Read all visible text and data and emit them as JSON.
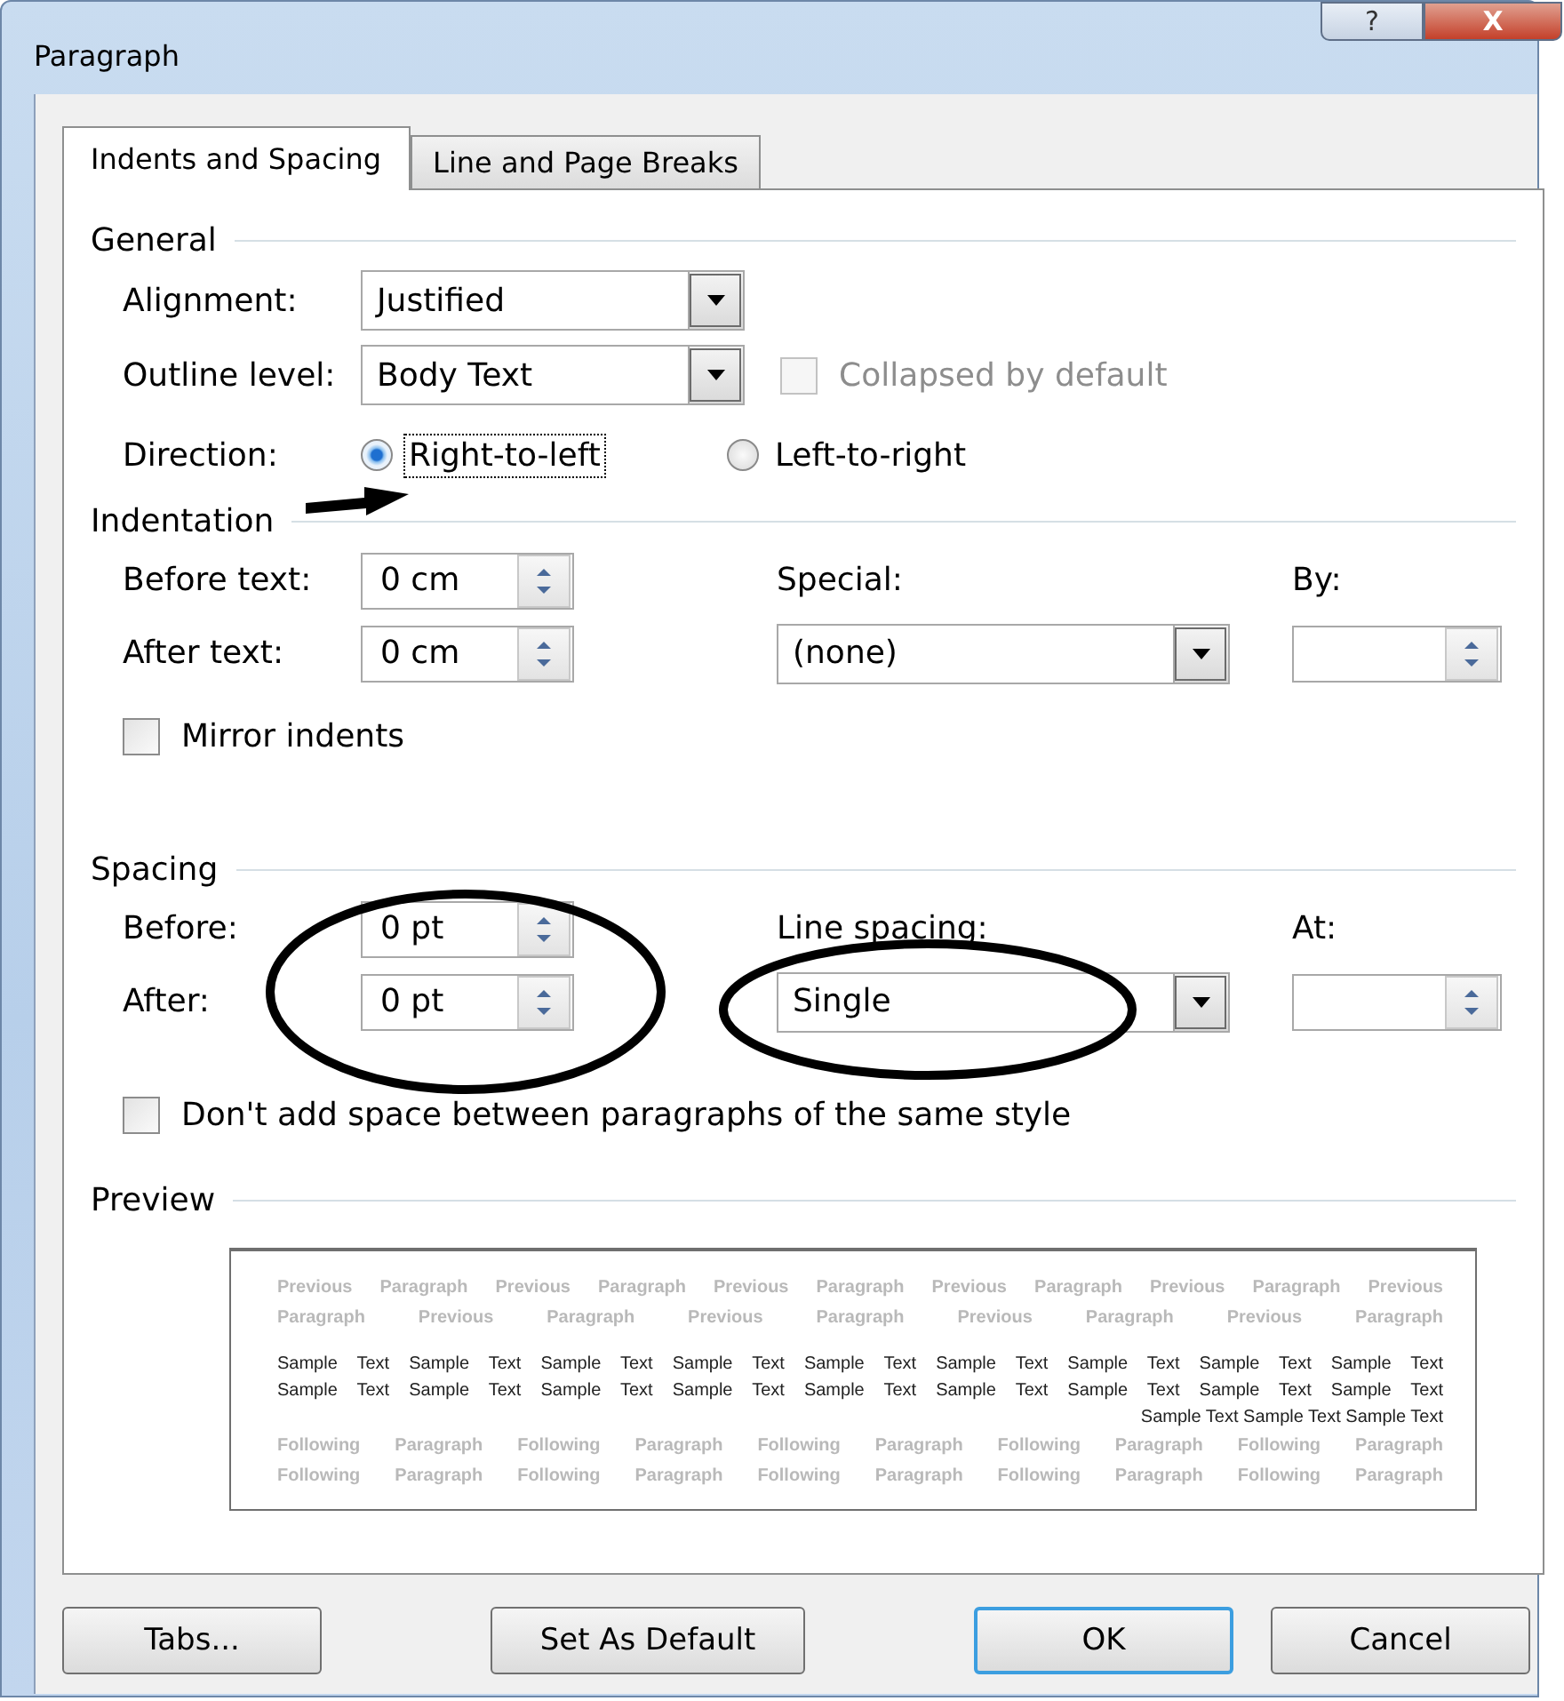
{
  "window": {
    "title": "Paragraph",
    "controls": [
      {
        "kind": "help",
        "label": "?"
      },
      {
        "kind": "close",
        "label": "X"
      }
    ]
  },
  "tabs": [
    {
      "label": "Indents and Spacing",
      "selected": true
    },
    {
      "label": "Line and Page Breaks",
      "selected": false
    }
  ],
  "general": {
    "heading": "General",
    "alignment": {
      "label": "Alignment:",
      "value": "Justified"
    },
    "outline_level": {
      "label": "Outline level:",
      "value": "Body Text"
    },
    "collapsed": {
      "label": "Collapsed by default",
      "checked": false,
      "disabled": true
    },
    "direction": {
      "label": "Direction:",
      "options": [
        {
          "label": "Right-to-left",
          "selected": true,
          "focused": true
        },
        {
          "label": "Left-to-right",
          "selected": false,
          "focused": false
        }
      ]
    }
  },
  "indentation": {
    "heading": "Indentation",
    "before_text": {
      "label": "Before text:",
      "value": "0 cm"
    },
    "after_text": {
      "label": "After text:",
      "value": "0 cm"
    },
    "special": {
      "label": "Special:",
      "value": "(none)"
    },
    "by": {
      "label": "By:"
    },
    "mirror": {
      "label": "Mirror indents",
      "checked": false
    }
  },
  "spacing": {
    "heading": "Spacing",
    "before": {
      "label": "Before:",
      "value": "0 pt"
    },
    "after": {
      "label": "After:",
      "value": "0 pt"
    },
    "line_spacing": {
      "label": "Line spacing:",
      "value": "Single"
    },
    "at": {
      "label": "At:"
    },
    "dont_add": {
      "label": "Don't add space between paragraphs of the same style",
      "checked": false
    }
  },
  "preview": {
    "heading": "Preview",
    "previous": [
      "Previous Paragraph Previous Paragraph Previous Paragraph Previous Paragraph Previous Paragraph Previous",
      "Paragraph Previous Paragraph Previous Paragraph Previous Paragraph Previous Paragraph"
    ],
    "sample": [
      "Sample Text Sample Text Sample Text Sample Text Sample Text Sample Text Sample Text Sample Text Sample Text",
      "Sample Text Sample Text Sample Text Sample Text Sample Text Sample Text Sample Text Sample Text Sample Text",
      "Sample Text Sample Text Sample Text"
    ],
    "following": [
      "Following Paragraph Following Paragraph Following Paragraph Following Paragraph Following Paragraph",
      "Following Paragraph Following Paragraph Following Paragraph Following Paragraph Following Paragraph"
    ]
  },
  "buttons": [
    {
      "label": "Tabs...",
      "default": false
    },
    {
      "label": "Set As Default",
      "default": false
    },
    {
      "label": "OK",
      "default": true
    },
    {
      "label": "Cancel",
      "default": false
    }
  ]
}
